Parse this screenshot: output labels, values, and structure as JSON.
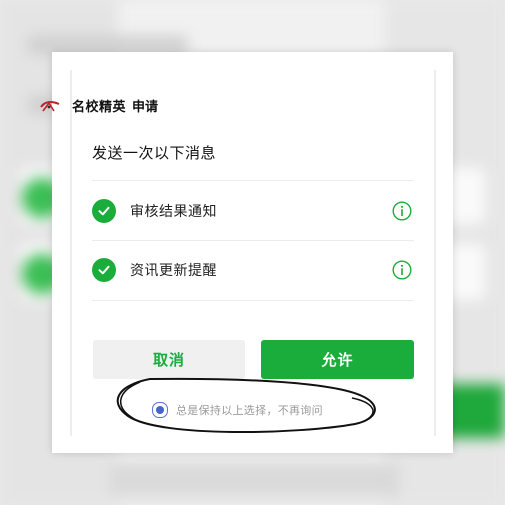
{
  "dialog": {
    "app_name": "名校精英",
    "verb": "申请",
    "subtitle": "发送一次以下消息",
    "items": [
      {
        "label": "审核结果通知",
        "checked": true
      },
      {
        "label": "资讯更新提醒",
        "checked": true
      }
    ],
    "cancel_label": "取消",
    "allow_label": "允许",
    "remember_label": "总是保持以上选择，不再询问",
    "remember_checked": true
  },
  "colors": {
    "accent_green": "#1aad3b",
    "radio_blue": "#4466cc",
    "muted_text": "#9a9a9a"
  },
  "icons": {
    "logo": "school-logo-icon",
    "check": "check-circle-icon",
    "info": "info-circle-icon",
    "radio": "radio-selected-icon"
  }
}
